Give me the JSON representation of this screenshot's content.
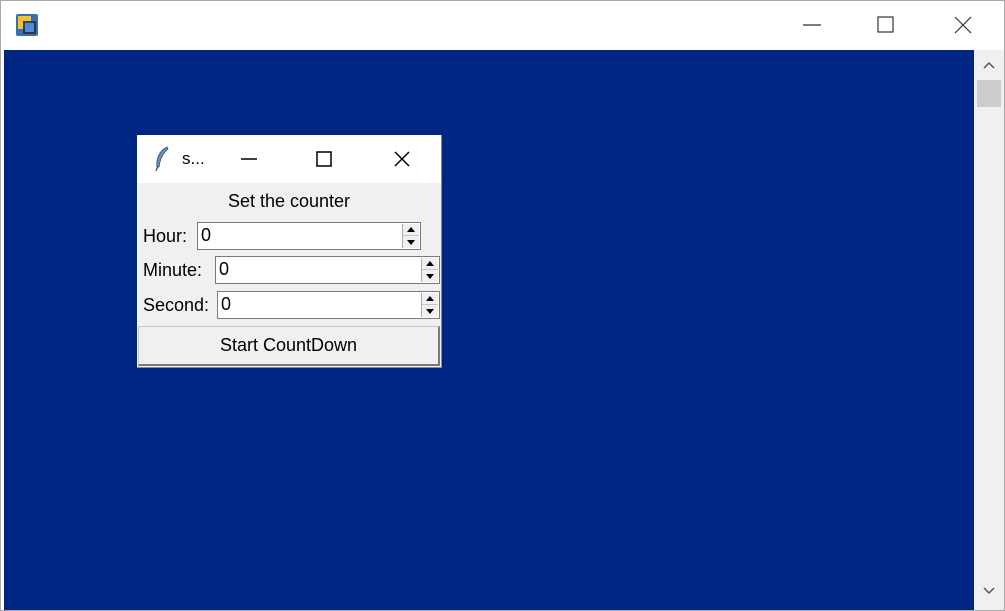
{
  "outer_window": {
    "title": "",
    "client_color": "#002583",
    "controls": [
      "minimize-icon",
      "maximize-icon",
      "close-icon"
    ]
  },
  "inner_window": {
    "title": "s...",
    "heading": "Set the counter",
    "fields": [
      {
        "label": "Hour:",
        "value": "0"
      },
      {
        "label": "Minute:",
        "value": "0"
      },
      {
        "label": "Second:",
        "value": "0"
      }
    ],
    "start_button": "Start CountDown"
  }
}
